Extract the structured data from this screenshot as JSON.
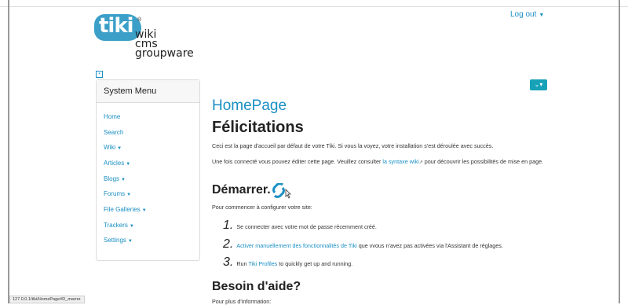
{
  "header": {
    "logout_label": "Log out",
    "logo": {
      "brand": "tiki",
      "reg": "®",
      "words": [
        "wiki",
        "cms",
        "groupware"
      ]
    },
    "collapse_icon": "square-toggle-icon",
    "action_icon": "chevron-down-icon"
  },
  "sidebar": {
    "title": "System Menu",
    "items": [
      {
        "label": "Home",
        "dropdown": false
      },
      {
        "label": "Search",
        "dropdown": false
      },
      {
        "label": "Wiki",
        "dropdown": true
      },
      {
        "label": "Articles",
        "dropdown": true
      },
      {
        "label": "Blogs",
        "dropdown": true
      },
      {
        "label": "Forums",
        "dropdown": true
      },
      {
        "label": "File Galleries",
        "dropdown": true
      },
      {
        "label": "Trackers",
        "dropdown": true
      },
      {
        "label": "Settings",
        "dropdown": true
      }
    ]
  },
  "main": {
    "page_title": "HomePage",
    "heading": "Félicitations",
    "para1": "Ceci est la page d'accueil par défaut de votre Tiki. Si vous la voyez, votre installation s'est déroulée avec succès.",
    "para2_before": "Une fois connecté vous pouvez éditer cette page. Veuillez consulter ",
    "para2_link": "la syntaxe wiki",
    "para2_after": " pour découvrir les possibilités de mise en page.",
    "start_heading": "Démarrer.",
    "start_intro": "Pour commencer à configurer votre site:",
    "steps": [
      {
        "num": "1.",
        "text": "Se connecter avec votre mot de passe récemment créé.",
        "link": "",
        "after": ""
      },
      {
        "num": "2.",
        "text": "",
        "link": "Activer manuellement des fonctionnalités de Tiki",
        "after": " que vvous n'avez pas activées via l'Assistant de réglages."
      },
      {
        "num": "3.",
        "text": "Run ",
        "link": "Tiki Profiles",
        "after": " to quickly get up and running."
      }
    ],
    "help_heading": "Besoin d'aide?",
    "help_intro": "Pour plus d'information:"
  },
  "status_bar": "127.0.0.1/tiki/HomePage#D_marrer."
}
